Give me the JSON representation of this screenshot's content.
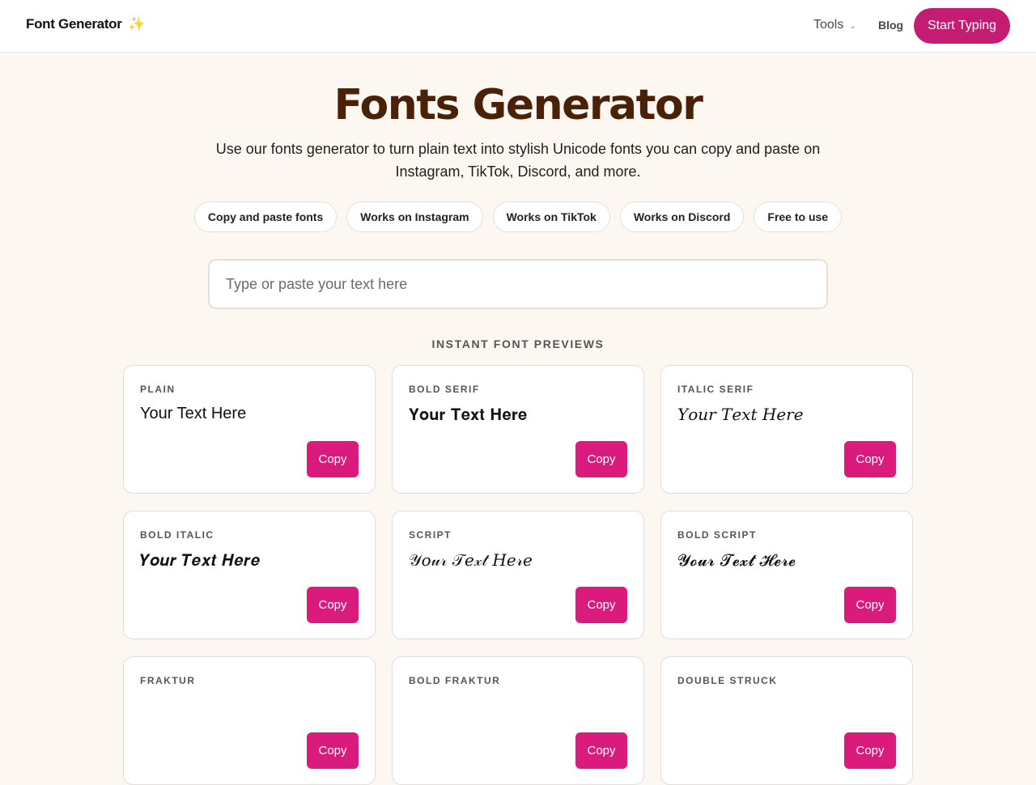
{
  "header": {
    "brand": "Font Generator",
    "brand_emoji": "✨",
    "nav_tools": "Tools",
    "nav_blog": "Blog",
    "cta": "Start Typing"
  },
  "hero": {
    "title": "Fonts Generator",
    "subtitle": "Use our fonts generator to turn plain text into stylish Unicode fonts you can copy and paste on Instagram, TikTok, Discord, and more."
  },
  "pills": [
    "Copy and paste fonts",
    "Works on Instagram",
    "Works on TikTok",
    "Works on Discord",
    "Free to use"
  ],
  "input": {
    "placeholder": "Type or paste your text here",
    "value": ""
  },
  "section_label": "INSTANT FONT PREVIEWS",
  "cards": [
    {
      "label": "PLAIN",
      "preview": "Your Text Here",
      "button": "Copy"
    },
    {
      "label": "BOLD SERIF",
      "preview": "𝐘𝐨𝐮𝐫 𝐓𝐞𝐱𝐭 𝐇𝐞𝐫𝐞",
      "button": "Copy"
    },
    {
      "label": "ITALIC SERIF",
      "preview": "𝑌𝑜𝑢𝑟 𝑇𝑒𝑥𝑡 𝐻𝑒𝑟𝑒",
      "button": "Copy"
    },
    {
      "label": "BOLD ITALIC",
      "preview": "𝒀𝒐𝒖𝒓 𝑻𝒆𝒙𝒕 𝑯𝒆𝒓𝒆",
      "button": "Copy"
    },
    {
      "label": "SCRIPT",
      "preview": "𝒴𝑜𝓊𝓇 𝒯𝑒𝓍𝓉 𝐻𝑒𝓇𝑒",
      "button": "Copy"
    },
    {
      "label": "BOLD SCRIPT",
      "preview": "𝓨𝓸𝓾𝓻 𝓣𝓮𝔁𝓽 𝓗𝓮𝓻𝓮",
      "button": "Copy"
    },
    {
      "label": "FRAKTUR",
      "preview": "",
      "button": "Copy"
    },
    {
      "label": "BOLD FRAKTUR",
      "preview": "",
      "button": "Copy"
    },
    {
      "label": "DOUBLE STRUCK",
      "preview": "",
      "button": "Copy"
    }
  ],
  "colors": {
    "accent": "#db1a7d",
    "cta": "#c41c72",
    "title": "#4a2006",
    "background": "#fdf7f1"
  },
  "icons": {
    "nav_tools": "chevron-down-icon",
    "brand": "sparkles-icon"
  }
}
